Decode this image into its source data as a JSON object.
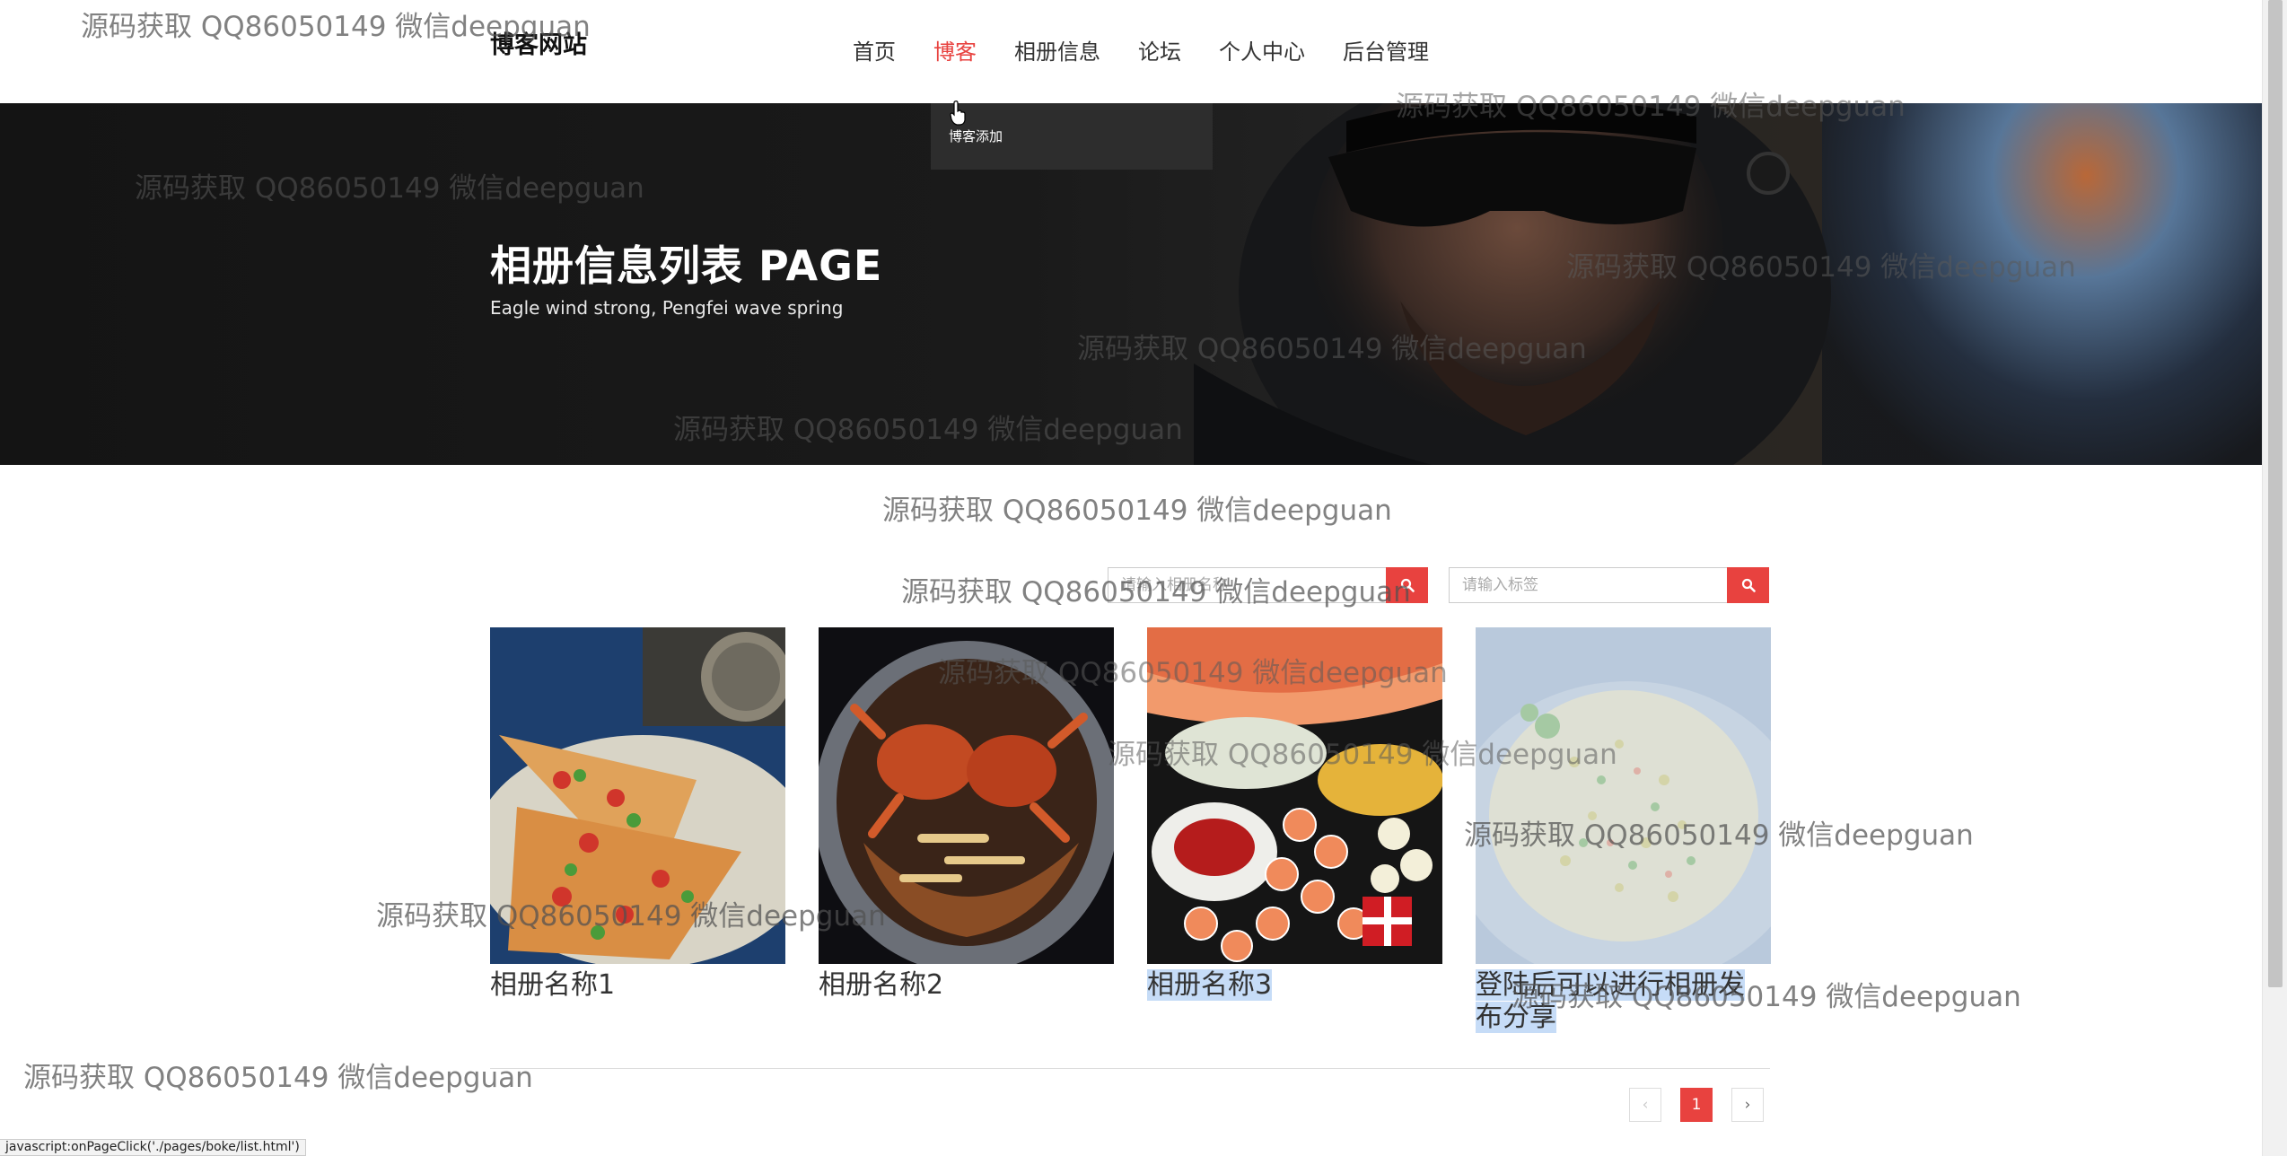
{
  "header": {
    "brand": "博客网站",
    "nav": [
      {
        "label": "首页",
        "active": false
      },
      {
        "label": "博客",
        "active": true
      },
      {
        "label": "相册信息",
        "active": false
      },
      {
        "label": "论坛",
        "active": false
      },
      {
        "label": "个人中心",
        "active": false
      },
      {
        "label": "后台管理",
        "active": false
      }
    ],
    "dropdown": {
      "items": [
        "博客添加"
      ]
    }
  },
  "banner": {
    "title": "相册信息列表 PAGE",
    "subtitle": "Eagle wind strong, Pengfei wave spring"
  },
  "search": {
    "name_placeholder": "请输入相册名称",
    "tag_placeholder": "请输入标签",
    "search_icon": "search-icon"
  },
  "albums": [
    {
      "title": "相册名称1",
      "image": "pizza-photo"
    },
    {
      "title": "相册名称2",
      "image": "crab-photo"
    },
    {
      "title": "相册名称3",
      "image": "seafood-platter-photo"
    },
    {
      "title": "登陆后可以进行相册发布分享",
      "image": "fried-rice-photo"
    }
  ],
  "pagination": {
    "prev": "‹",
    "current": "1",
    "next": "›"
  },
  "status_bar": "javascript:onPageClick('./pages/boke/list.html')",
  "watermark": "源码获取 QQ86050149 微信deepguan",
  "colors": {
    "accent": "#e8423f",
    "banner_bg": "#1a1a1a",
    "selection": "#c6dcf7"
  }
}
